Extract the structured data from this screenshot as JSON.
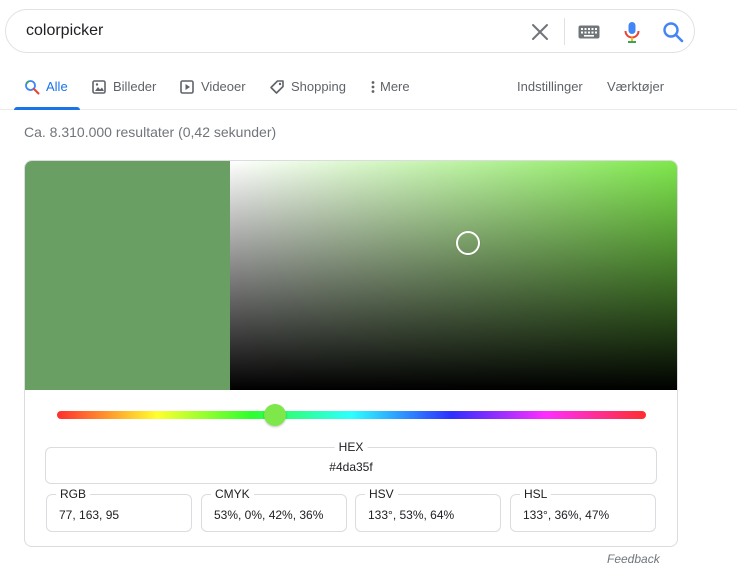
{
  "search": {
    "query": "colorpicker",
    "icons": [
      "close-icon",
      "keyboard-icon",
      "microphone-icon",
      "search-icon"
    ]
  },
  "tabs": [
    {
      "label": "Alle",
      "icon": "search-icon",
      "active": true
    },
    {
      "label": "Billeder",
      "icon": "image-icon",
      "active": false
    },
    {
      "label": "Videoer",
      "icon": "play-icon",
      "active": false
    },
    {
      "label": "Shopping",
      "icon": "tag-icon",
      "active": false
    },
    {
      "label": "Mere",
      "icon": "more-vert-icon",
      "active": false
    }
  ],
  "tools": {
    "settings_label": "Indstillinger",
    "tools_label": "Værktøjer"
  },
  "stats": "Ca. 8.310.000 resultater (0,42 sekunder)",
  "colorpicker": {
    "selected_color": "#6a9f63",
    "hue_color": "#7ee84b",
    "hue_degrees": 133,
    "hsv_saturation": 0.53,
    "hsv_value": 0.64,
    "hex_label": "HEX",
    "hex_value": "#4da35f",
    "rgb_label": "RGB",
    "rgb_value": "77, 163, 95",
    "cmyk_label": "CMYK",
    "cmyk_value": "53%, 0%, 42%, 36%",
    "hsv_label": "HSV",
    "hsv_value_text": "133°, 53%, 64%",
    "hsl_label": "HSL",
    "hsl_value": "133°, 36%, 47%"
  },
  "feedback": "Feedback",
  "colors": {
    "accent": "#1a73e8",
    "mic_blue": "#4285f4",
    "mic_red": "#ea4335",
    "text_secondary": "#5f6368"
  }
}
